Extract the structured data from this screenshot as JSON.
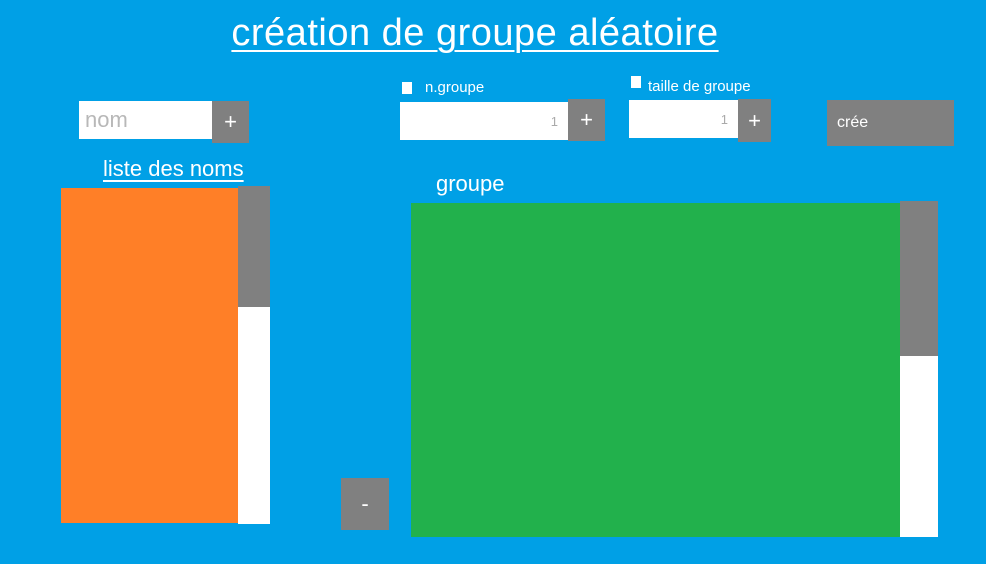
{
  "title": "création de  groupe aléatoire",
  "name_entry": {
    "placeholder": "nom",
    "add_label": "+"
  },
  "group_count": {
    "label": "n.groupe",
    "value": "1",
    "add_label": "+"
  },
  "group_size": {
    "label": "taille de groupe",
    "value": "1",
    "add_label": "+"
  },
  "create_label": "crée",
  "names_list": {
    "heading": "liste des noms",
    "items": []
  },
  "remove_label": "-",
  "groups": {
    "heading": "groupe",
    "items": []
  },
  "colors": {
    "background": "#00A0E6",
    "names_list": "#FF7F27",
    "groups_panel": "#22B14C",
    "button": "#808080"
  }
}
